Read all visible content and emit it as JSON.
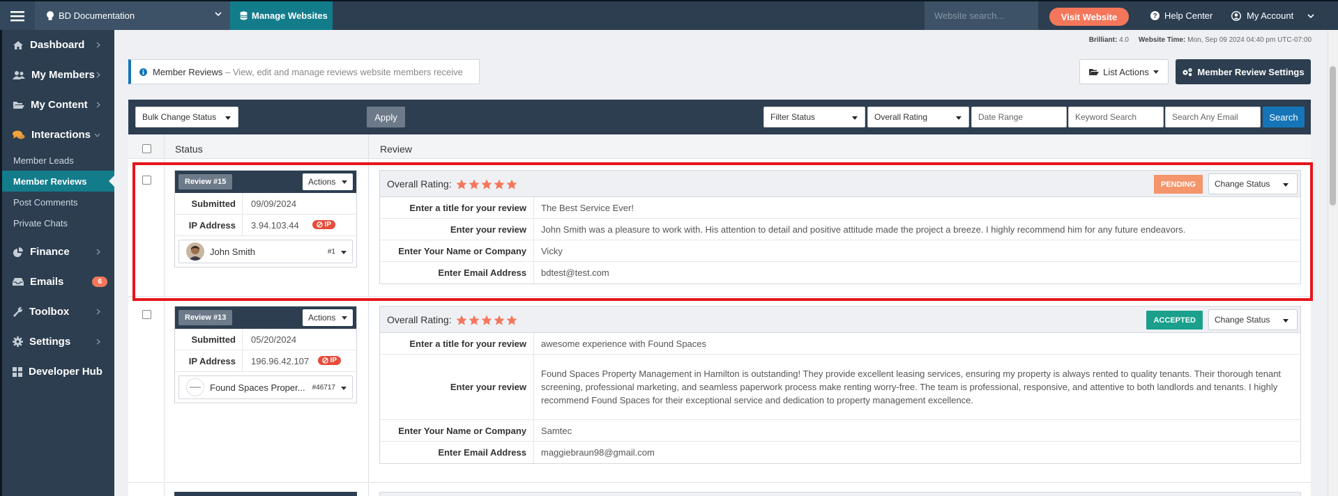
{
  "topbar": {
    "site_name": "BD Documentation",
    "manage_label": "Manage Websites",
    "search_placeholder": "Website search...",
    "visit_label": "Visit Website",
    "help_label": "Help Center",
    "account_label": "My Account"
  },
  "sidebar": {
    "dashboard": "Dashboard",
    "my_members": "My Members",
    "my_content": "My Content",
    "interactions": "Interactions",
    "sub_items": [
      "Member Leads",
      "Member Reviews",
      "Post Comments",
      "Private Chats"
    ],
    "finance": "Finance",
    "emails": "Emails",
    "emails_badge": "6",
    "toolbox": "Toolbox",
    "settings": "Settings",
    "developer_hub": "Developer Hub"
  },
  "meta": {
    "version_label": "Brilliant:",
    "version": "4.0",
    "time_label": "Website Time:",
    "time": "Mon, Sep 09 2024 04:40 pm UTC-07:00"
  },
  "header": {
    "title": "Member Reviews",
    "description": " – View, edit and manage reviews website members receive",
    "list_actions": "List Actions",
    "settings_button": "Member Review Settings"
  },
  "toolbar": {
    "bulk_status": "Bulk Change Status",
    "apply": "Apply",
    "filter_status": "Filter Status",
    "overall_rating": "Overall Rating",
    "date_range_placeholder": "Date Range",
    "keyword_placeholder": "Keyword Search",
    "email_placeholder": "Search Any Email",
    "search": "Search"
  },
  "table": {
    "col_status": "Status",
    "col_review": "Review"
  },
  "labels": {
    "actions": "Actions",
    "submitted": "Submitted",
    "ip_address": "IP Address",
    "ip_badge": "IP",
    "overall_rating": "Overall Rating:",
    "change_status": "Change Status",
    "title_field": "Enter a title for your review",
    "review_field": "Enter your review",
    "name_field": "Enter Your Name or Company",
    "email_field": "Enter Email Address"
  },
  "reviews": [
    {
      "number": "Review #15",
      "submitted": "09/09/2024",
      "ip": "3.94.103.44",
      "member_name": "John Smith",
      "member_id": "#1",
      "rating": 5,
      "status": "PENDING",
      "status_color": "#f4956b",
      "title": "The Best Service Ever!",
      "review": "John Smith was a pleasure to work with. His attention to detail and positive attitude made the project a breeze. I highly recommend him for any future endeavors.",
      "name": "Vicky",
      "email": "bdtest@test.com"
    },
    {
      "number": "Review #13",
      "submitted": "05/20/2024",
      "ip": "196.96.42.107",
      "member_name": "Found Spaces Proper...",
      "member_id": "#46717",
      "rating": 5,
      "status": "ACCEPTED",
      "status_color": "#1aa08c",
      "title": "awesome experience with Found Spaces",
      "review": "Found Spaces Property Management in Hamilton is outstanding! They provide excellent leasing services, ensuring my property is always rented to quality tenants. Their thorough tenant screening, professional marketing, and seamless paperwork process make renting worry-free. The team is professional, responsive, and attentive to both landlords and tenants. I highly recommend Found Spaces for their exceptional service and dedication to property management excellence.",
      "name": "Samtec",
      "email": "maggiebraun98@gmail.com"
    }
  ],
  "colors": {
    "navy": "#2c3e50",
    "teal": "#137c8b",
    "orange": "#f4775b",
    "blue": "#1575b8",
    "highlight": "#e5161b"
  }
}
